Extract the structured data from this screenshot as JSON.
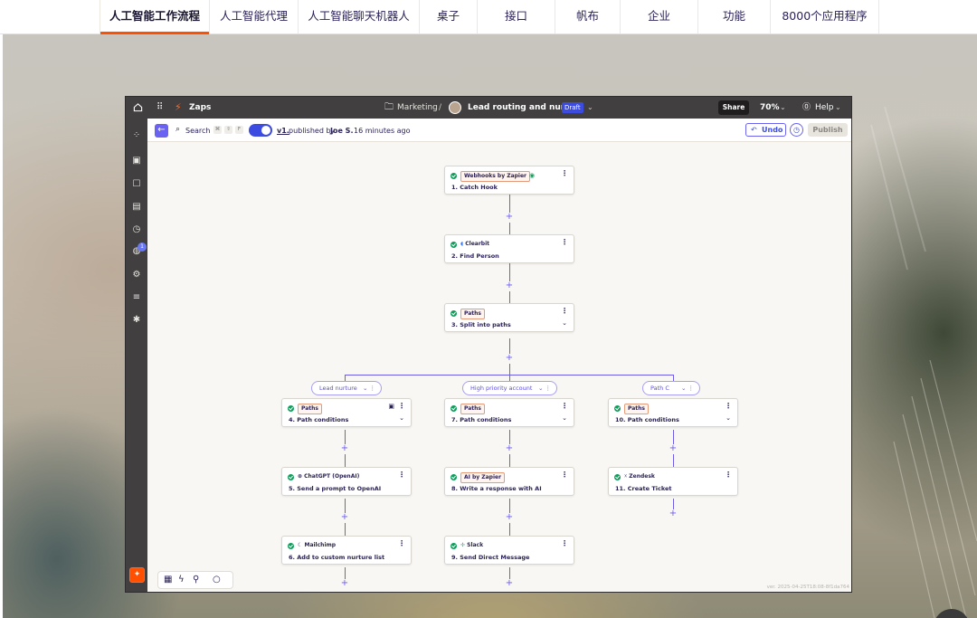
{
  "site_nav": {
    "tabs": [
      {
        "label": "人工智能工作流程",
        "active": true
      },
      {
        "label": "人工智能代理"
      },
      {
        "label": "人工智能聊天机器人"
      },
      {
        "label": "桌子"
      },
      {
        "label": "接口"
      },
      {
        "label": "帆布"
      },
      {
        "label": "企业"
      },
      {
        "label": "功能"
      },
      {
        "label": "8000个应用程序"
      }
    ]
  },
  "editor": {
    "header": {
      "app_name": "Zaps",
      "folder": "Marketing",
      "separator": "/",
      "zap_title": "Lead routing and nurture",
      "status_badge": "Draft",
      "share_label": "Share",
      "zoom": "70%",
      "help_label": "Help"
    },
    "sidebar": {
      "notification_count": "1"
    },
    "toolbar": {
      "search_label": "Search",
      "shortcut_keys": [
        "⌘",
        "⇧",
        "F"
      ],
      "version_link": "v1.",
      "published_text": "published by",
      "published_by": "Joe S.",
      "published_time": "16 minutes ago",
      "undo_label": "Undo",
      "publish_label": "Publish"
    },
    "steps": [
      {
        "app": "Webhooks by Zapier",
        "title": "1. Catch Hook"
      },
      {
        "app": "Clearbit",
        "title": "2. Find Person"
      },
      {
        "app": "Paths",
        "title": "3. Split into paths"
      }
    ],
    "paths": [
      {
        "name": "Lead nurture",
        "steps": [
          {
            "app": "Paths",
            "title": "4. Path conditions"
          },
          {
            "app": "ChatGPT (OpenAI)",
            "title": "5. Send a prompt to OpenAI"
          },
          {
            "app": "Mailchimp",
            "title": "6. Add to custom nurture list"
          }
        ]
      },
      {
        "name": "High priority account",
        "steps": [
          {
            "app": "Paths",
            "title": "7. Path conditions"
          },
          {
            "app": "AI by Zapier",
            "title": "8. Write a response with AI"
          },
          {
            "app": "Slack",
            "title": "9. Send Direct Message"
          }
        ]
      },
      {
        "name": "Path C",
        "steps": [
          {
            "app": "Paths",
            "title": "10. Path conditions"
          },
          {
            "app": "Zendesk",
            "title": "11. Create Ticket"
          }
        ]
      }
    ],
    "version_footer": "ver. 2025-04-25T18:08-8f1da764",
    "colors": {
      "accent": "#ff4f00",
      "path_line": "#6c5ce7",
      "app_chrome": "#413f3f",
      "toggle": "#3d4ce0"
    }
  }
}
